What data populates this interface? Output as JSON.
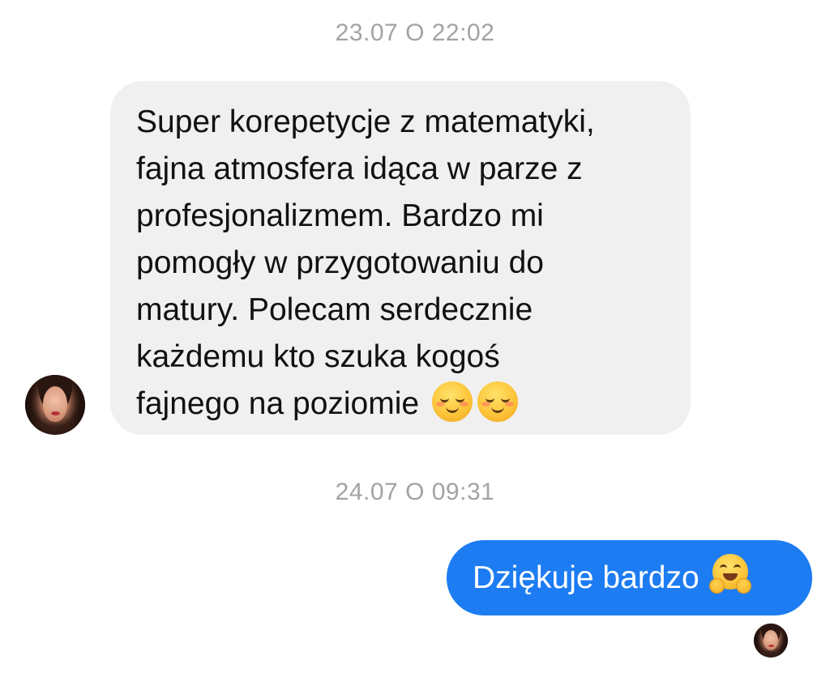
{
  "conversation": {
    "messages": [
      {
        "timestamp": "23.07 O 22:02",
        "direction": "incoming",
        "lines": [
          "Super korepetycje z matematyki,",
          "fajna atmosfera idąca w parze z",
          "profesjonalizmem. Bardzo mi",
          "pomogły w przygotowaniu do",
          "matury. Polecam serdecznie",
          "każdemu kto szuka kogoś",
          "fajnego na poziomie"
        ],
        "emoji": [
          "smiling-face-icon",
          "smiling-face-icon"
        ],
        "avatar": "sender-avatar"
      },
      {
        "timestamp": "24.07 O 09:31",
        "direction": "outgoing",
        "text": "Dziękuje bardzo",
        "emoji": [
          "hugging-face-icon"
        ],
        "read_receipt": "sender-avatar"
      }
    ]
  },
  "colors": {
    "incoming_bubble": "#f0f0f0",
    "outgoing_bubble": "#1d7cf2",
    "timestamp_text": "#a3a3a3",
    "incoming_text": "#111111",
    "outgoing_text": "#ffffff"
  }
}
